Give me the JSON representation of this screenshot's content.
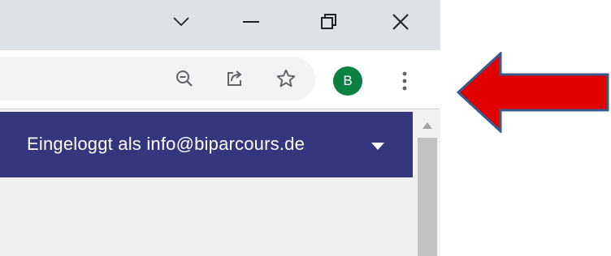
{
  "header": {
    "user_label": "Eingeloggt als info@biparcours.de"
  },
  "profile": {
    "avatar_initial": "B"
  },
  "icons": {
    "minimize_tabs": "chevron-down-icon",
    "minimize": "minimize-icon",
    "restore": "restore-icon",
    "close": "close-icon",
    "zoom": "zoom-out-icon",
    "share": "share-icon",
    "bookmark": "star-icon",
    "menu": "more-vertical-icon",
    "user_menu": "caret-down-icon",
    "annotation": "red-arrow-left"
  },
  "colors": {
    "titlebar": "#dee1e6",
    "header_bg": "#35367c",
    "avatar_bg": "#0b8043",
    "annotation_arrow": "#e00000",
    "annotation_arrow_border": "#3a5a8c"
  }
}
